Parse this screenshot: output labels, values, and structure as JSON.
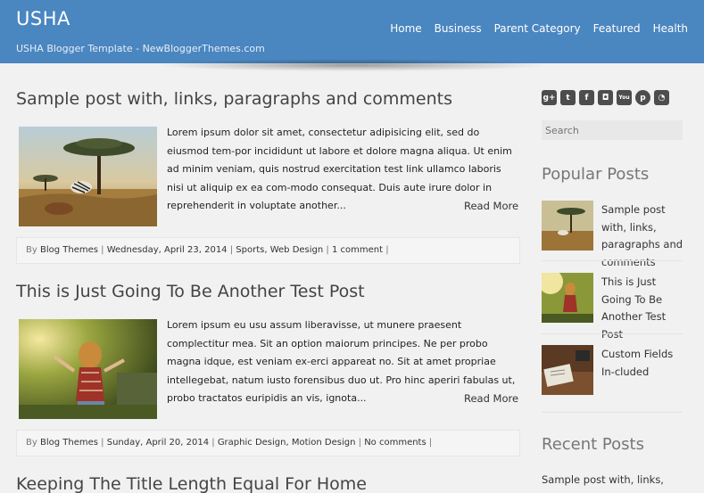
{
  "header": {
    "title": "USHA",
    "description": "USHA Blogger Template - NewBloggerThemes.com",
    "nav": [
      "Home",
      "Business",
      "Parent Category",
      "Featured",
      "Health"
    ]
  },
  "posts": [
    {
      "title": "Sample post with, links, paragraphs and comments",
      "excerpt": "Lorem ipsum dolor sit amet, consectetur adipisicing elit, sed do eiusmod tem-por incididunt ut labore et dolore magna aliqua. Ut enim ad minim veniam, quis nostrud exercitation test link ullamco laboris nisi ut aliquip ex ea com-modo consequat. Duis aute irure dolor in reprehenderit in voluptate another...",
      "read_more": "Read More",
      "meta": {
        "by": "By",
        "author": "Blog Themes",
        "sep": "|",
        "date": "Wednesday, April 23, 2014",
        "labels": [
          "Sports",
          "Web Design"
        ],
        "comments": "1 comment"
      }
    },
    {
      "title": "This is Just Going To Be Another Test Post",
      "excerpt": "Lorem ipsum eu usu assum liberavisse, ut munere praesent complectitur mea. Sit an option maiorum principes. Ne per probo magna idque, est veniam ex-erci appareat no. Sit at amet propriae intellegebat, natum iusto forensibus duo ut. Pro hinc aperiri fabulas ut, probo tractatos euripidis an vis, ignota...",
      "read_more": "Read More",
      "meta": {
        "by": "By",
        "author": "Blog Themes",
        "sep": "|",
        "date": "Sunday, April 20, 2014",
        "labels": [
          "Graphic Design",
          "Motion Design"
        ],
        "comments": "No comments"
      }
    },
    {
      "title": "Keeping The Title Length Equal For Home"
    }
  ],
  "sidebar": {
    "social_icons": [
      "google-plus-icon",
      "twitter-icon",
      "facebook-icon",
      "instagram-icon",
      "youtube-icon",
      "pinterest-icon",
      "rss-icon"
    ],
    "search_placeholder": "Search",
    "popular_title": "Popular Posts",
    "popular": [
      "Sample post with, links, paragraphs and comments",
      "This is Just Going To Be Another Test Post",
      "Custom Fields In-cluded"
    ],
    "recent_title": "Recent Posts",
    "recent_first": "Sample post with, links, para-"
  },
  "colors": {
    "header": "#4a86c0",
    "background": "#f1f1f1",
    "icon": "#4d4d4d"
  }
}
